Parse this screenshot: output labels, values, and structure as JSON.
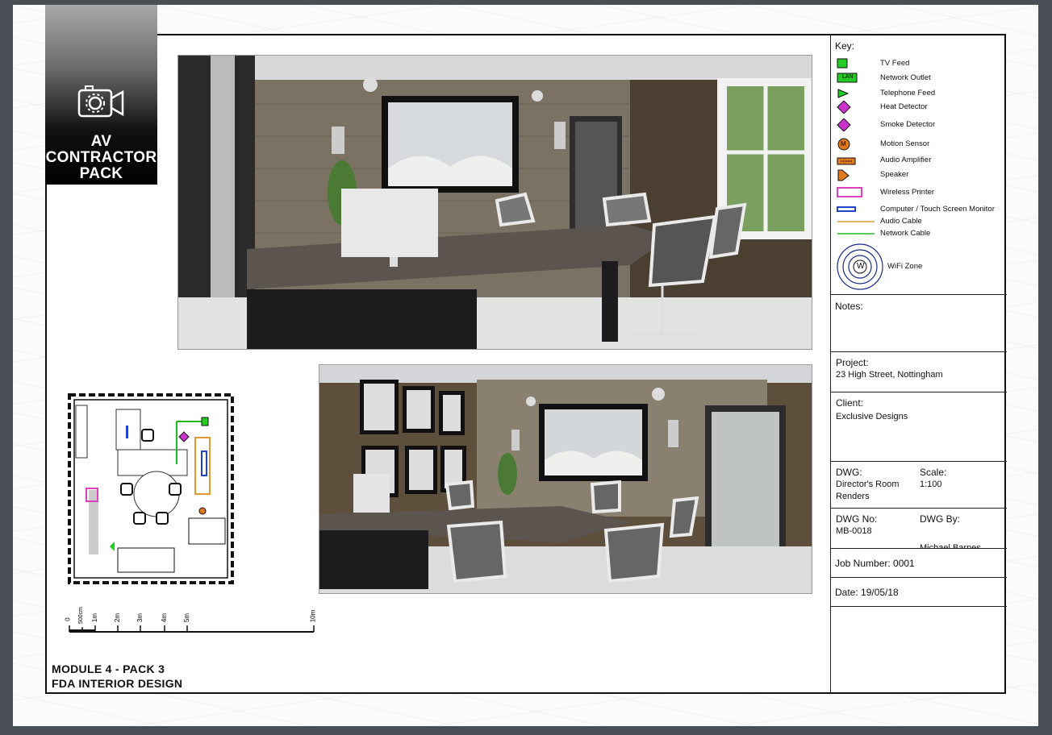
{
  "badge": {
    "line1": "AV",
    "line2": "CONTRACTOR",
    "line3": "PACK",
    "icon": "camera-gear-icon"
  },
  "key": {
    "title": "Key:",
    "items": [
      {
        "label": "TV Feed",
        "icon": "tv-feed-symbol"
      },
      {
        "label": "Network Outlet",
        "icon": "network-outlet-symbol",
        "tag": "LAN"
      },
      {
        "label": "Telephone Feed",
        "icon": "telephone-feed-symbol"
      },
      {
        "label": "Heat Detector",
        "icon": "heat-detector-symbol"
      },
      {
        "label": "Smoke Detector",
        "icon": "smoke-detector-symbol"
      },
      {
        "label": "Motion Sensor",
        "icon": "motion-sensor-symbol",
        "tag": "M"
      },
      {
        "label": "Audio Amplifier",
        "icon": "audio-amplifier-symbol"
      },
      {
        "label": "Speaker",
        "icon": "speaker-symbol"
      },
      {
        "label": "Wireless Printer",
        "icon": "wireless-printer-symbol"
      },
      {
        "label": "Computer / Touch Screen Monitor",
        "icon": "monitor-symbol"
      },
      {
        "label": "Audio Cable",
        "icon": "audio-cable-line"
      },
      {
        "label": "Network Cable",
        "icon": "network-cable-line"
      },
      {
        "label": "WiFi Zone",
        "icon": "wifi-zone-symbol",
        "tag": "W"
      }
    ]
  },
  "notes": {
    "label": "Notes:"
  },
  "project": {
    "label": "Project:",
    "value": "23 High Street, Nottingham"
  },
  "client": {
    "label": "Client:",
    "value": "Exclusive Designs"
  },
  "dwg": {
    "label": "DWG:",
    "value_line1": "Director's Room",
    "value_line2": "Renders"
  },
  "scale_box": {
    "label": "Scale:",
    "value": "1:100"
  },
  "dwg_no": {
    "label": "DWG No:",
    "value": "MB-0018"
  },
  "dwg_by": {
    "label": "DWG By:",
    "value": "Michael Barnes"
  },
  "job": {
    "label": "Job Number: 0001"
  },
  "date": {
    "label": "Date: 19/05/18"
  },
  "scalebar": {
    "labels": [
      "0",
      "500cm",
      "1m",
      "2m",
      "3m",
      "4m",
      "5m",
      "10m"
    ]
  },
  "footer": {
    "line1": "MODULE 4 - PACK 3",
    "line2": "FDA INTERIOR DESIGN"
  },
  "colors": {
    "tv_feed": "#22cc22",
    "detector": "#cc33cc",
    "motion": "#e07a1f",
    "printer": "#e040c0",
    "monitor": "#2244cc",
    "audio_cable": "#e09a30",
    "network_cable": "#22bb22",
    "wifi": "#1a2a8c"
  }
}
